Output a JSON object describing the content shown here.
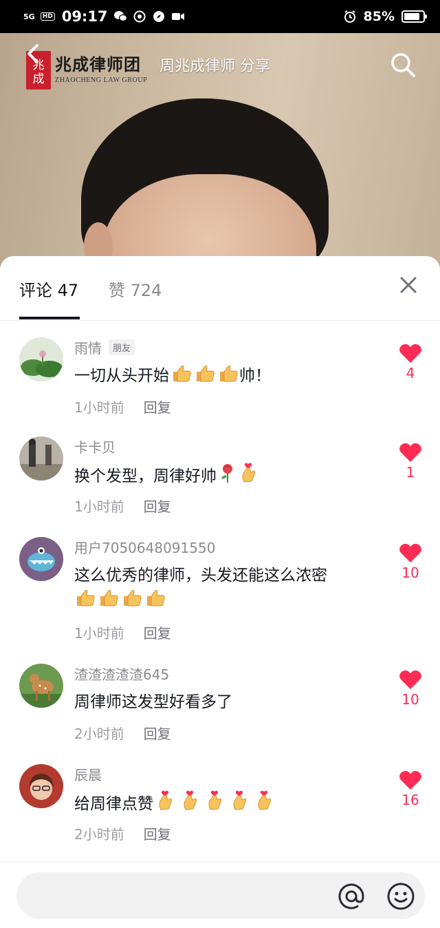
{
  "status_bar": {
    "network": "5G",
    "hd": "HD",
    "time": "09:17",
    "battery": "85%",
    "battery_level": 0.85
  },
  "video": {
    "title": "周兆成律师 分享",
    "logo_cn": "兆成律师团",
    "logo_en": "ZHAOCHENG LAW GROUP",
    "logo_seal": "兆成"
  },
  "tabs": {
    "comments_label": "评论 47",
    "likes_label": "赞 724"
  },
  "comments": [
    {
      "user": "雨情",
      "badge": "朋友",
      "text": "一切从头开始",
      "time": "1小时前",
      "reply": "回复",
      "likes": "4"
    },
    {
      "user": "卡卡贝",
      "text": "换个发型，周律好帅",
      "time": "1小时前",
      "reply": "回复",
      "likes": "1"
    },
    {
      "user": "用户7050648091550",
      "text": "这么优秀的律师，头发还能这么浓密",
      "time": "1小时前",
      "reply": "回复",
      "likes": "10"
    },
    {
      "user": "渣渣渣渣渣645",
      "text": "周律师这发型好看多了",
      "time": "2小时前",
      "reply": "回复",
      "likes": "10"
    },
    {
      "user": "辰晨",
      "text": "给周律点赞",
      "time": "2小时前",
      "reply": "回复",
      "likes": "16"
    }
  ],
  "comment_suffix": {
    "c0": "帅！"
  },
  "input": {
    "placeholder": ""
  },
  "colors": {
    "accent": "#fe2c55",
    "text_primary": "#161823",
    "text_secondary": "#8a8b91"
  },
  "icons": [
    "back-icon",
    "search-icon",
    "close-icon",
    "heart-icon",
    "at-icon",
    "emoji-icon",
    "thumbs-up-emoji",
    "rose-emoji",
    "finger-heart-emoji"
  ]
}
